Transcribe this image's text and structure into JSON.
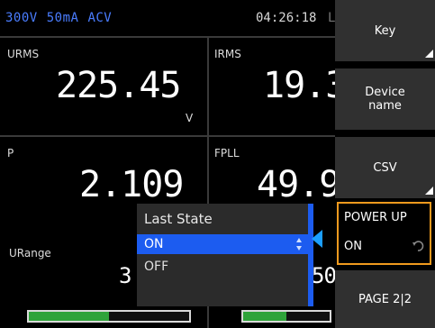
{
  "status": {
    "range_voltage": "300V",
    "range_current": "50mA",
    "mode": "ACV",
    "time": "04:26:18",
    "extra": "L"
  },
  "tiles": {
    "urms": {
      "label": "URMS",
      "value": "225.45",
      "unit": "V"
    },
    "irms": {
      "label": "IRMS",
      "value": "19.3"
    },
    "p": {
      "label": "P",
      "value": "2.109"
    },
    "fpll": {
      "label": "FPLL",
      "value": "49.9"
    },
    "urange": {
      "label": "URange",
      "value": "3",
      "bar_fraction": 0.5
    },
    "right_bottom": {
      "value": "50",
      "bar_fraction": 0.5
    }
  },
  "popup": {
    "title": "Last State",
    "options": [
      "ON",
      "OFF"
    ],
    "selected": "ON"
  },
  "softkeys": {
    "key": "Key",
    "device_name_line1": "Device",
    "device_name_line2": "name",
    "csv": "CSV",
    "power_up_title": "POWER UP",
    "power_up_value": "ON",
    "page": "PAGE 2|2"
  },
  "colors": {
    "accent_blue": "#1c5cf0",
    "status_blue": "#4a7dff",
    "highlight_orange": "#f09a1e",
    "bar_green": "#2fa33a"
  }
}
